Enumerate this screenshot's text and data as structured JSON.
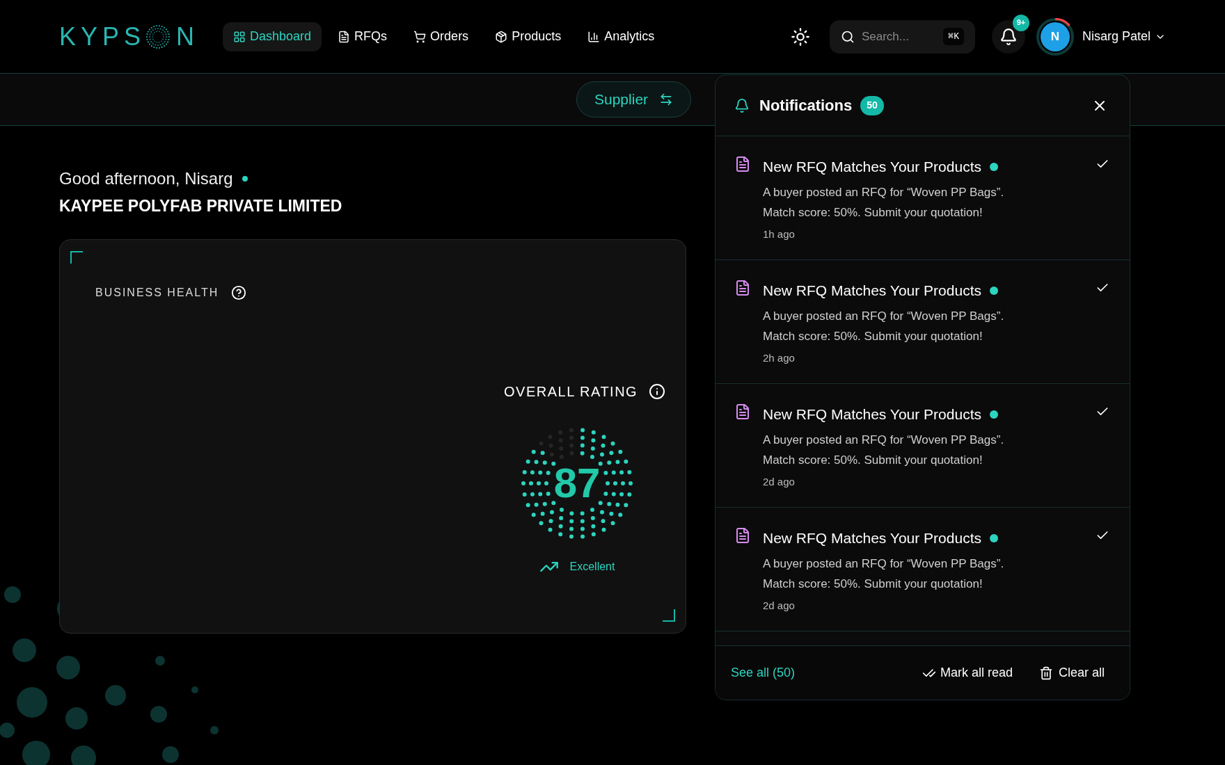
{
  "logo": {
    "start": "KYPS",
    "end": "N"
  },
  "nav": [
    {
      "label": "Dashboard",
      "selected": true
    },
    {
      "label": "RFQs",
      "selected": false
    },
    {
      "label": "Orders",
      "selected": false
    },
    {
      "label": "Products",
      "selected": false
    },
    {
      "label": "Analytics",
      "selected": false
    }
  ],
  "search": {
    "placeholder": "Search...",
    "shortcut": "⌘K"
  },
  "bell_badge": "9+",
  "user": {
    "initial": "N",
    "name": "Nisarg Patel"
  },
  "role_button": "Supplier",
  "greeting": "Good afternoon, Nisarg",
  "online": true,
  "company": "KAYPEE POLYFAB PRIVATE LIMITED",
  "health_card": {
    "title": "BUSINESS HEALTH",
    "rating_title": "OVERALL RATING",
    "score": "87",
    "level": 0.87,
    "status": "Excellent"
  },
  "notifications": {
    "title": "Notifications",
    "count": "50",
    "items": [
      {
        "title": "New RFQ Matches Your Products",
        "unread": true,
        "body": "A buyer posted an RFQ for “Woven PP Bags”. Match score: 50%. Submit your quotation!",
        "time": "1h ago"
      },
      {
        "title": "New RFQ Matches Your Products",
        "unread": true,
        "body": "A buyer posted an RFQ for “Woven PP Bags”. Match score: 50%. Submit your quotation!",
        "time": "2h ago"
      },
      {
        "title": "New RFQ Matches Your Products",
        "unread": true,
        "body": "A buyer posted an RFQ for “Woven PP Bags”. Match score: 50%. Submit your quotation!",
        "time": "2d ago"
      },
      {
        "title": "New RFQ Matches Your Products",
        "unread": true,
        "body": "A buyer posted an RFQ for “Woven PP Bags”. Match score: 50%. Submit your quotation!",
        "time": "2d ago"
      }
    ],
    "see_all": "See all (50)",
    "mark_all": "Mark all read",
    "clear_all": "Clear all"
  }
}
